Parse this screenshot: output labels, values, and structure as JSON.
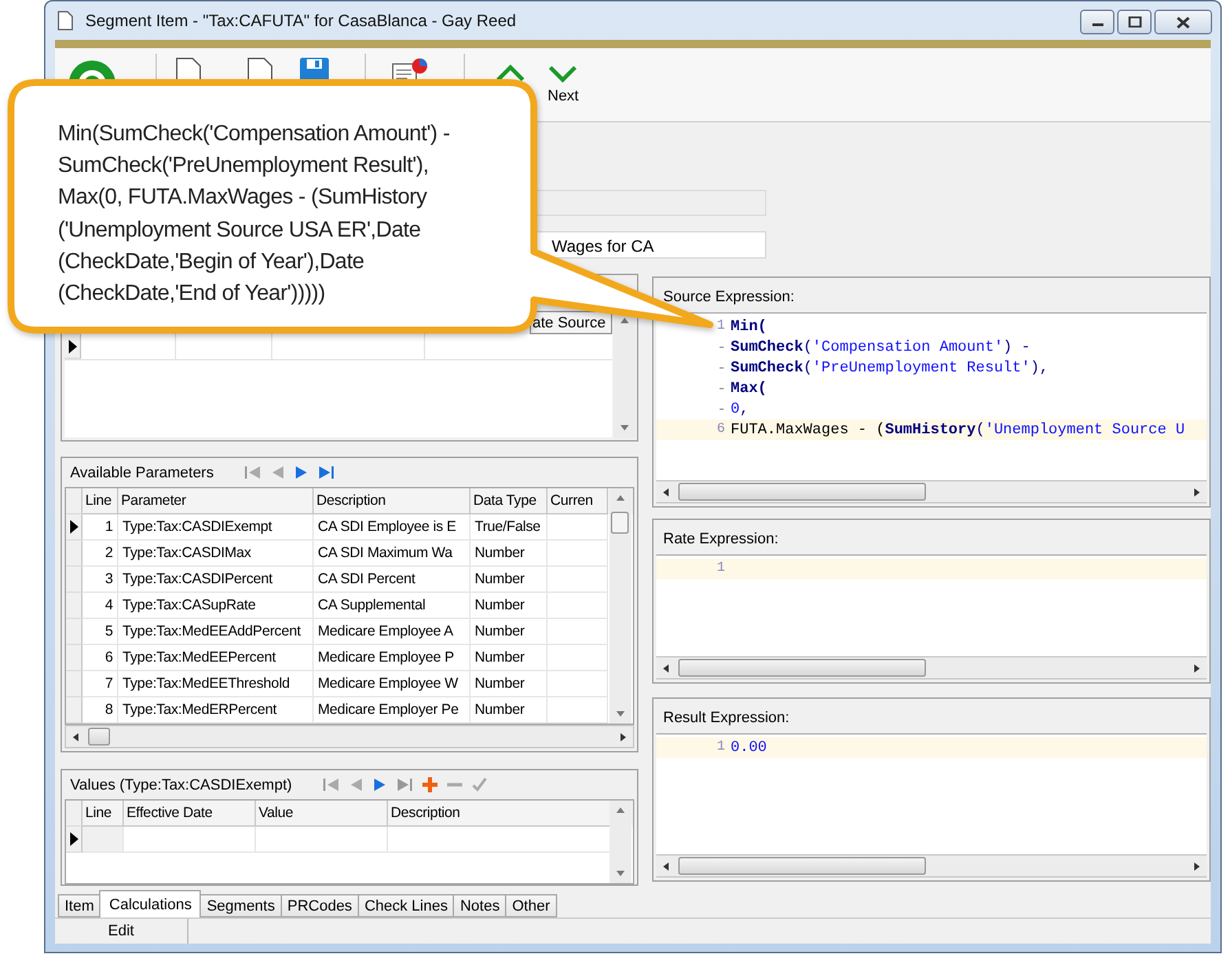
{
  "window": {
    "title": "Segment Item - \"Tax:CAFUTA\" for CasaBlanca - Gay Reed"
  },
  "toolbar": {
    "next_label": "Next"
  },
  "form": {
    "fields": [
      {
        "disabled": true
      },
      {
        "disabled": false,
        "value": "Wages for CA"
      }
    ]
  },
  "top_grid": {
    "columns": [
      "ate Source"
    ]
  },
  "parameters": {
    "title": "Available Parameters",
    "columns": [
      "Line",
      "Parameter",
      "Description",
      "Data Type",
      "Curren"
    ],
    "rows": [
      {
        "line": "1",
        "parameter": "Type:Tax:CASDIExempt",
        "description": "CA SDI Employee is E",
        "data_type": "True/False",
        "selected": true
      },
      {
        "line": "2",
        "parameter": "Type:Tax:CASDIMax",
        "description": "CA SDI Maximum Wa",
        "data_type": "Number",
        "selected": false
      },
      {
        "line": "3",
        "parameter": "Type:Tax:CASDIPercent",
        "description": "CA SDI Percent",
        "data_type": "Number",
        "selected": false
      },
      {
        "line": "4",
        "parameter": "Type:Tax:CASupRate",
        "description": "CA Supplemental",
        "data_type": "Number",
        "selected": false
      },
      {
        "line": "5",
        "parameter": "Type:Tax:MedEEAddPercent",
        "description": "Medicare Employee A",
        "data_type": "Number",
        "selected": false
      },
      {
        "line": "6",
        "parameter": "Type:Tax:MedEEPercent",
        "description": "Medicare Employee P",
        "data_type": "Number",
        "selected": false
      },
      {
        "line": "7",
        "parameter": "Type:Tax:MedEEThreshold",
        "description": "Medicare Employee W",
        "data_type": "Number",
        "selected": false
      },
      {
        "line": "8",
        "parameter": "Type:Tax:MedERPercent",
        "description": "Medicare Employer Pe",
        "data_type": "Number",
        "selected": false
      }
    ]
  },
  "values": {
    "title": "Values (Type:Tax:CASDIExempt)",
    "columns": [
      "Line",
      "Effective Date",
      "Value",
      "Description"
    ]
  },
  "editors": [
    {
      "label": "Source Expression:",
      "lines": [
        {
          "number": "1",
          "current": false,
          "tokens": [
            {
              "text": "Min(",
              "kind": "keyword"
            }
          ]
        },
        {
          "current": false,
          "tokens": [
            {
              "text": "SumCheck",
              "kind": "keyword"
            },
            {
              "text": "(",
              "kind": "punct"
            },
            {
              "text": "'Compensation Amount'",
              "kind": "string"
            },
            {
              "text": ") -",
              "kind": "punct"
            }
          ]
        },
        {
          "current": false,
          "tokens": [
            {
              "text": "SumCheck",
              "kind": "keyword"
            },
            {
              "text": "(",
              "kind": "punct"
            },
            {
              "text": "'PreUnemployment Result'",
              "kind": "string"
            },
            {
              "text": "),",
              "kind": "punct"
            }
          ]
        },
        {
          "current": false,
          "tokens": [
            {
              "text": "Max(",
              "kind": "keyword"
            }
          ]
        },
        {
          "current": false,
          "tokens": [
            {
              "text": "0",
              "kind": "number"
            },
            {
              "text": ",",
              "kind": "punct"
            }
          ]
        },
        {
          "number": "6",
          "current": true,
          "tokens": [
            {
              "text": "FUTA.MaxWages - (",
              "kind": "plain"
            },
            {
              "text": "SumHistory",
              "kind": "keyword"
            },
            {
              "text": "(",
              "kind": "punct"
            },
            {
              "text": "'Unemployment Source U",
              "kind": "string"
            }
          ]
        }
      ]
    },
    {
      "label": "Rate Expression:",
      "lines": [
        {
          "number": "1",
          "current": true
        }
      ]
    },
    {
      "label": "Result Expression:",
      "lines": [
        {
          "number": "1",
          "current": true,
          "tokens": [
            {
              "text": "0.00",
              "kind": "number"
            }
          ]
        }
      ]
    }
  ],
  "tabs": [
    {
      "label": "Item",
      "selected": false
    },
    {
      "label": "Calculations",
      "selected": true
    },
    {
      "label": "Segments",
      "selected": false
    },
    {
      "label": "PRCodes",
      "selected": false
    },
    {
      "label": "Check Lines",
      "selected": false
    },
    {
      "label": "Notes",
      "selected": false
    },
    {
      "label": "Other",
      "selected": false
    }
  ],
  "status_bar": [
    "Edit"
  ],
  "callout": {
    "lines": [
      "Min(SumCheck('Compensation Amount') -",
      "SumCheck('PreUnemployment Result'),",
      "Max(0, FUTA.MaxWages - (SumHistory",
      "('Unemployment Source USA ER',Date",
      "(CheckDate,'Begin of Year'),Date",
      "(CheckDate,'End of Year')))))"
    ]
  }
}
